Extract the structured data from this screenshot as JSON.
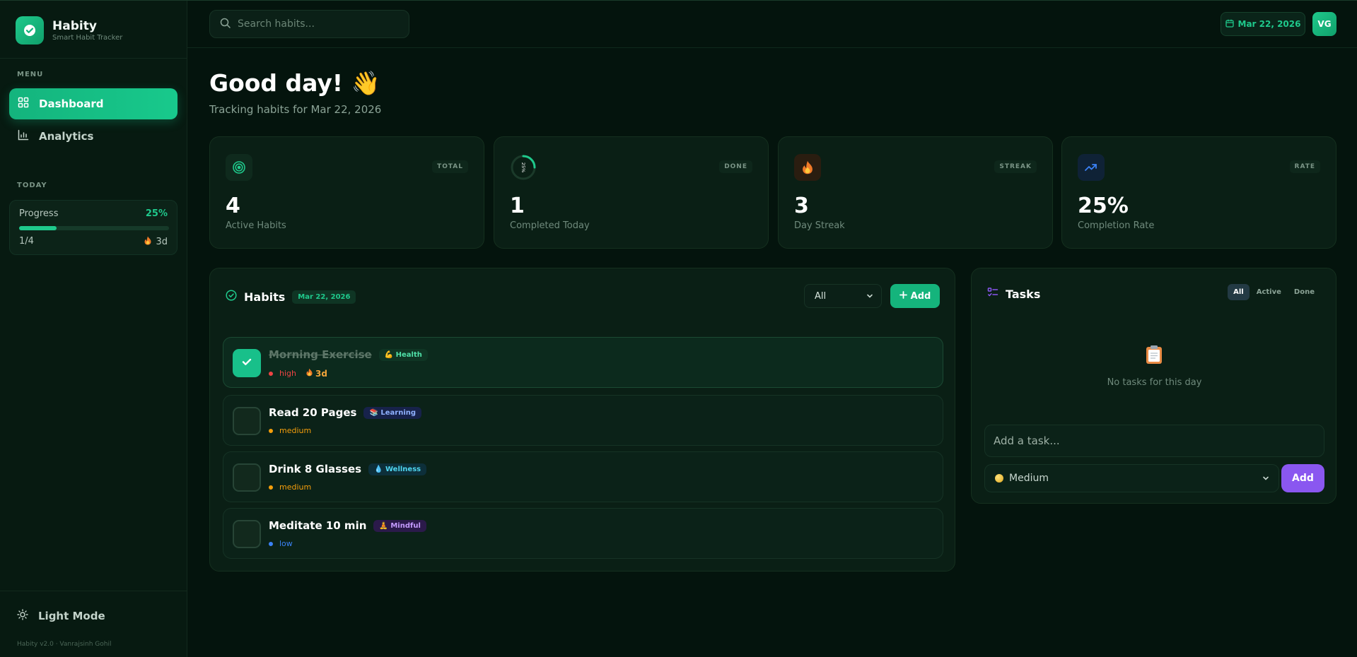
{
  "brand": {
    "name": "Habity",
    "tagline": "Smart Habit Tracker"
  },
  "sidebar": {
    "menu_label": "MENU",
    "items": [
      {
        "label": "Dashboard",
        "icon": "grid-icon",
        "active": true
      },
      {
        "label": "Analytics",
        "icon": "bar-chart-icon",
        "active": false
      }
    ],
    "today_label": "TODAY",
    "progress": {
      "label": "Progress",
      "percent_text": "25%",
      "fraction": 0.25,
      "count": "1/4",
      "streak": "3d"
    },
    "light_mode_label": "Light Mode",
    "footer": "Habity v2.0 · Vanrajsinh Gohil"
  },
  "topbar": {
    "search_placeholder": "Search habits...",
    "date": "Mar 22, 2026",
    "avatar_initials": "VG"
  },
  "header": {
    "greeting": "Good day! 👋",
    "subtitle": "Tracking habits for Mar 22, 2026"
  },
  "stats": [
    {
      "tag": "TOTAL",
      "value": "4",
      "label": "Active Habits"
    },
    {
      "tag": "DONE",
      "value": "1",
      "label": "Completed Today",
      "ring_text": "25%"
    },
    {
      "tag": "STREAK",
      "value": "3",
      "label": "Day Streak"
    },
    {
      "tag": "RATE",
      "value": "25%",
      "label": "Completion Rate"
    }
  ],
  "habits_panel": {
    "title": "Habits",
    "date": "Mar 22, 2026",
    "filter_value": "All",
    "add_label": "Add",
    "habits": [
      {
        "name": "Morning Exercise",
        "category": "💪 Health",
        "priority": "high",
        "streak": "3d",
        "done": true
      },
      {
        "name": "Read 20 Pages",
        "category": "📚 Learning",
        "priority": "medium",
        "done": false
      },
      {
        "name": "Drink 8 Glasses",
        "category": "💧 Wellness",
        "priority": "medium",
        "done": false
      },
      {
        "name": "Meditate 10 min",
        "category": "🧘 Mindful",
        "priority": "low",
        "done": false
      }
    ]
  },
  "tasks_panel": {
    "title": "Tasks",
    "tabs": [
      "All",
      "Active",
      "Done"
    ],
    "empty_text": "No tasks for this day",
    "input_placeholder": "Add a task...",
    "priority_value": "Medium",
    "add_label": "Add"
  },
  "colors": {
    "accent": "#1fc98c",
    "priority_high": "#ef4444",
    "priority_medium": "#f59e0b",
    "priority_low": "#3b82f6",
    "task_add": "#8a57f0"
  }
}
